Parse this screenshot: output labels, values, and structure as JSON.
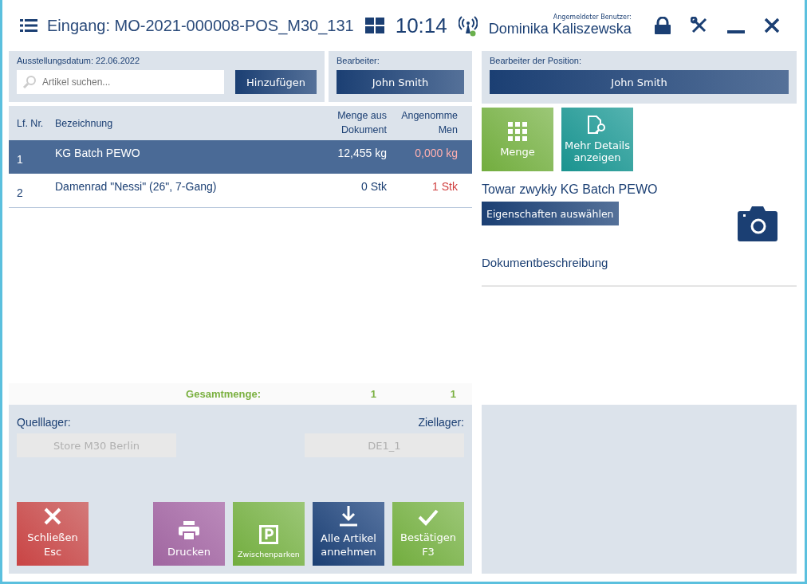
{
  "header": {
    "title": "Eingang: MO-2021-000008-POS_M30_131",
    "time": "10:14",
    "user_label": "Angemeldeter Benutzer:",
    "user_name": "Dominika Kaliszewska"
  },
  "document": {
    "date_label": "Ausstellungsdatum: 22.06.2022",
    "search": {
      "placeholder": "Artikel suchen..."
    },
    "add_button": "Hinzufügen",
    "editor_label": "Bearbeiter:",
    "editor": "John Smith"
  },
  "table": {
    "columns": [
      "Lf. Nr.",
      "Bezeichnung",
      "Menge aus Dokument",
      "Angenomme Men"
    ],
    "rows": [
      {
        "no": "1",
        "name": "KG Batch PEWO",
        "document_qty": "12,455 kg",
        "accepted_qty": "0,000 kg",
        "selected": true
      },
      {
        "no": "2",
        "name": "Damenrad \"Nessi\" (26\", 7-Gang)",
        "document_qty": "0 Stk",
        "accepted_qty": "1 Stk",
        "selected": false
      }
    ],
    "total_label": "Gesamtmenge:",
    "total_document": "1",
    "total_accepted": "1"
  },
  "warehouses": {
    "source_label": "Quelllager:",
    "source": "Store M30 Berlin",
    "target_label": "Ziellager:",
    "target": "DE1_1"
  },
  "actions": [
    {
      "kind": "close",
      "label": "Schließen",
      "key": "Esc"
    },
    {
      "kind": "print",
      "label": "Drucken"
    },
    {
      "kind": "park",
      "label": "Zwischenparken"
    },
    {
      "kind": "accept",
      "label": "Alle Artikel annehmen"
    },
    {
      "kind": "confirm",
      "label": "Bestätigen",
      "key": "F3"
    }
  ],
  "position": {
    "editor_label": "Bearbeiter der Position:",
    "editor": "John Smith",
    "tiles": [
      {
        "kind": "quantity",
        "label": "Menge"
      },
      {
        "kind": "details",
        "label": "Mehr Details anzeigen"
      }
    ],
    "item_title": "Towar zwykły KG Batch PEWO",
    "properties_button": "Eigenschaften auswählen",
    "description_label": "Dokumentbeschreibung"
  }
}
